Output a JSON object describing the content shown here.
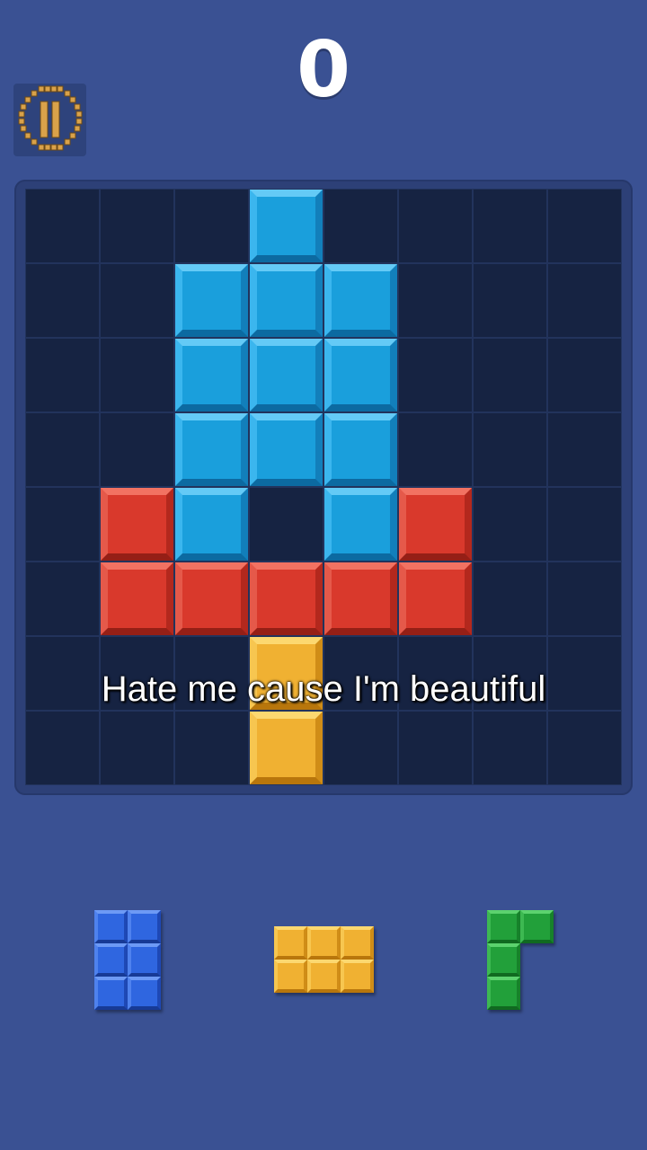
{
  "score": "0",
  "pause_button": {
    "icon": "pause-icon"
  },
  "board": {
    "rows": 8,
    "cols": 8,
    "blocks": [
      {
        "row": 0,
        "col": 3,
        "color": "blue"
      },
      {
        "row": 1,
        "col": 2,
        "color": "blue"
      },
      {
        "row": 1,
        "col": 3,
        "color": "blue"
      },
      {
        "row": 1,
        "col": 4,
        "color": "blue"
      },
      {
        "row": 2,
        "col": 2,
        "color": "blue"
      },
      {
        "row": 2,
        "col": 3,
        "color": "blue"
      },
      {
        "row": 2,
        "col": 4,
        "color": "blue"
      },
      {
        "row": 3,
        "col": 2,
        "color": "blue"
      },
      {
        "row": 3,
        "col": 3,
        "color": "blue"
      },
      {
        "row": 3,
        "col": 4,
        "color": "blue"
      },
      {
        "row": 4,
        "col": 1,
        "color": "red"
      },
      {
        "row": 4,
        "col": 2,
        "color": "blue"
      },
      {
        "row": 4,
        "col": 4,
        "color": "blue"
      },
      {
        "row": 4,
        "col": 5,
        "color": "red"
      },
      {
        "row": 5,
        "col": 1,
        "color": "red"
      },
      {
        "row": 5,
        "col": 2,
        "color": "red"
      },
      {
        "row": 5,
        "col": 3,
        "color": "red"
      },
      {
        "row": 5,
        "col": 4,
        "color": "red"
      },
      {
        "row": 5,
        "col": 5,
        "color": "red"
      },
      {
        "row": 6,
        "col": 3,
        "color": "yellow"
      },
      {
        "row": 7,
        "col": 3,
        "color": "yellow"
      }
    ]
  },
  "caption": "Hate me cause I'm beautiful",
  "pieces": [
    {
      "name": "blue-3x2-piece",
      "color": "blue",
      "cells": [
        [
          0,
          0
        ],
        [
          0,
          1
        ],
        [
          1,
          0
        ],
        [
          1,
          1
        ],
        [
          2,
          0
        ],
        [
          2,
          1
        ]
      ]
    },
    {
      "name": "yellow-2x3-piece",
      "color": "yellow",
      "cells": [
        [
          0,
          0
        ],
        [
          0,
          1
        ],
        [
          0,
          2
        ],
        [
          1,
          0
        ],
        [
          1,
          1
        ],
        [
          1,
          2
        ]
      ]
    },
    {
      "name": "green-corner-piece",
      "color": "green",
      "cells": [
        [
          0,
          0
        ],
        [
          0,
          1
        ],
        [
          1,
          0
        ],
        [
          2,
          0
        ]
      ]
    }
  ],
  "colors": {
    "background": "#3a5193",
    "board": "#162342",
    "blue": "#1a9fdc",
    "red": "#d9392c",
    "yellow": "#f0b132",
    "green": "#22a03a",
    "tray_blue": "#2f66e0"
  }
}
